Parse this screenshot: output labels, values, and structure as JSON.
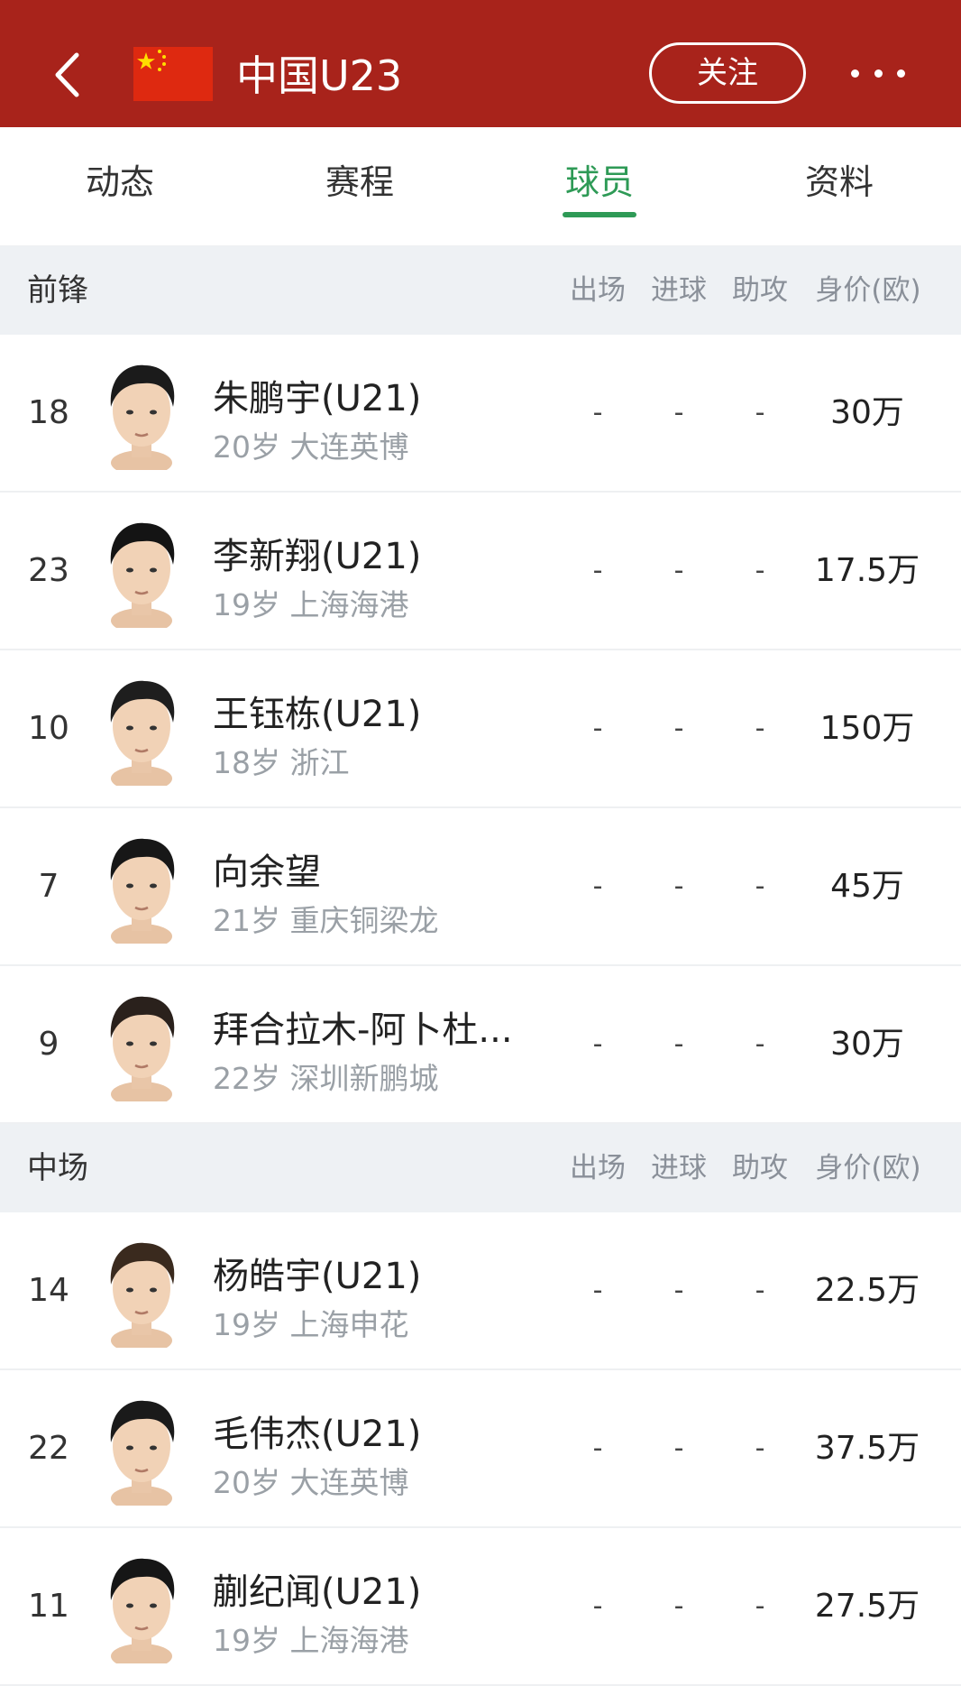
{
  "header": {
    "team_name": "中国U23",
    "follow_label": "关注",
    "back_icon": "chevron-left-icon",
    "more_icon": "more-dots-icon",
    "flag_icon": "china-flag-icon",
    "bg_color": "#a8231b"
  },
  "tabs": [
    {
      "label": "动态",
      "active": false
    },
    {
      "label": "赛程",
      "active": false
    },
    {
      "label": "球员",
      "active": true
    },
    {
      "label": "资料",
      "active": false
    }
  ],
  "accent_color": "#2e9a56",
  "columns": {
    "apps": "出场",
    "goals": "进球",
    "assists": "助攻",
    "value": "身价(欧)"
  },
  "sections": [
    {
      "title": "前锋",
      "players": [
        {
          "number": "18",
          "name": "朱鹏宇(U21)",
          "meta": "20岁 大连英博",
          "apps": "-",
          "goals": "-",
          "assists": "-",
          "value": "30万"
        },
        {
          "number": "23",
          "name": "李新翔(U21)",
          "meta": "19岁 上海海港",
          "apps": "-",
          "goals": "-",
          "assists": "-",
          "value": "17.5万"
        },
        {
          "number": "10",
          "name": "王钰栋(U21)",
          "meta": "18岁 浙江",
          "apps": "-",
          "goals": "-",
          "assists": "-",
          "value": "150万"
        },
        {
          "number": "7",
          "name": "向余望",
          "meta": "21岁 重庆铜梁龙",
          "apps": "-",
          "goals": "-",
          "assists": "-",
          "value": "45万"
        },
        {
          "number": "9",
          "name": "拜合拉木-阿卜杜...",
          "meta": "22岁 深圳新鹏城",
          "apps": "-",
          "goals": "-",
          "assists": "-",
          "value": "30万"
        }
      ]
    },
    {
      "title": "中场",
      "players": [
        {
          "number": "14",
          "name": "杨皓宇(U21)",
          "meta": "19岁 上海申花",
          "apps": "-",
          "goals": "-",
          "assists": "-",
          "value": "22.5万"
        },
        {
          "number": "22",
          "name": "毛伟杰(U21)",
          "meta": "20岁 大连英博",
          "apps": "-",
          "goals": "-",
          "assists": "-",
          "value": "37.5万"
        },
        {
          "number": "11",
          "name": "蒯纪闻(U21)",
          "meta": "19岁 上海海港",
          "apps": "-",
          "goals": "-",
          "assists": "-",
          "value": "27.5万"
        }
      ]
    }
  ]
}
